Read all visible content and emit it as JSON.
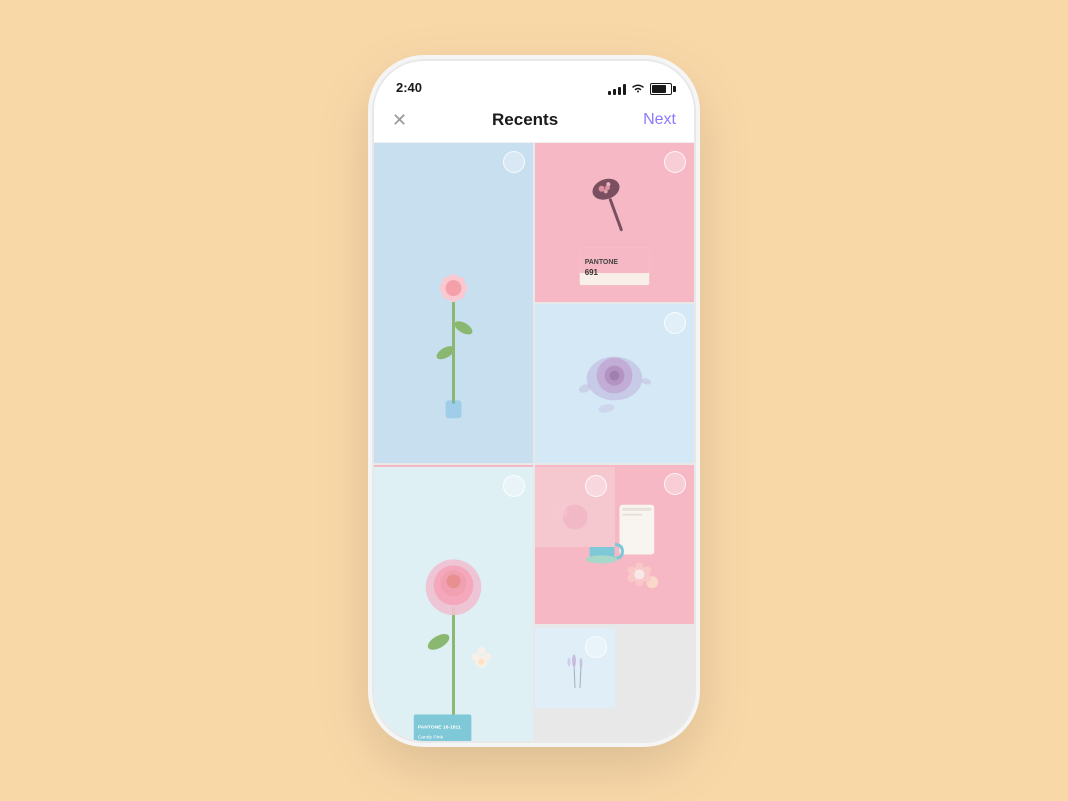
{
  "status": {
    "time": "2:40",
    "signal_label": "signal",
    "wifi_label": "wifi",
    "battery_label": "battery"
  },
  "nav": {
    "close_label": "✕",
    "title": "Recents",
    "next_label": "Next"
  },
  "photos": [
    {
      "id": "photo-1",
      "bg": "blue-light",
      "type": "flower-tall",
      "tall": true
    },
    {
      "id": "photo-2",
      "bg": "pink-light",
      "type": "pantone-spoon"
    },
    {
      "id": "photo-3",
      "bg": "blue-pale",
      "type": "flower-purple"
    },
    {
      "id": "photo-4",
      "bg": "pink-light",
      "type": "lollipop"
    },
    {
      "id": "photo-5",
      "bg": "pink-light",
      "type": "objects"
    },
    {
      "id": "photo-6",
      "bg": "blue-light",
      "type": "flower-pink-tall",
      "tall": true
    },
    {
      "id": "photo-7",
      "bg": "pink-light",
      "type": "partial-pink"
    },
    {
      "id": "photo-8",
      "bg": "blue-pale",
      "type": "partial-lavender"
    }
  ],
  "pantone": {
    "brand": "PANTONE",
    "number": "691",
    "brand2": "PANTONE 16-1811",
    "name": "Candy Pink"
  },
  "colors": {
    "background": "#F9D8A8",
    "phone_bg": "#ffffff",
    "accent_purple": "#8b7aff",
    "pink_light": "#f5b8c4",
    "blue_light": "#c8dff0",
    "blue_pale": "#d4e8f5"
  }
}
